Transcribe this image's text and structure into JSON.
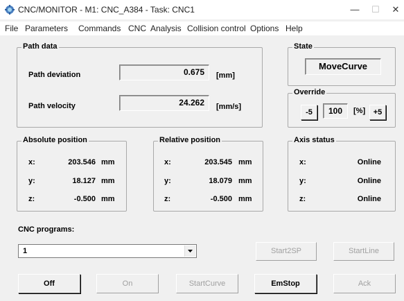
{
  "window": {
    "title": "CNC/MONITOR - M1: CNC_A384 - Task: CNC1",
    "minimize_glyph": "—",
    "maximize_glyph": "☐",
    "close_glyph": "✕"
  },
  "menu": [
    "File",
    "Parameters",
    "Commands",
    "CNC",
    "Analysis",
    "Collision control",
    "Options",
    "Help"
  ],
  "path_data": {
    "title": "Path data",
    "deviation_label": "Path deviation",
    "deviation_value": "0.675",
    "deviation_unit": "[mm]",
    "velocity_label": "Path velocity",
    "velocity_value": "24.262",
    "velocity_unit": "[mm/s]"
  },
  "state": {
    "title": "State",
    "value": "MoveCurve"
  },
  "override": {
    "title": "Override",
    "minus_label": "-5",
    "value": "100",
    "unit": "[%]",
    "plus_label": "+5"
  },
  "absolute_position": {
    "title": "Absolute position",
    "rows": [
      {
        "axis": "x:",
        "value": "203.546",
        "unit": "mm"
      },
      {
        "axis": "y:",
        "value": "18.127",
        "unit": "mm"
      },
      {
        "axis": "z:",
        "value": "-0.500",
        "unit": "mm"
      }
    ]
  },
  "relative_position": {
    "title": "Relative position",
    "rows": [
      {
        "axis": "x:",
        "value": "203.545",
        "unit": "mm"
      },
      {
        "axis": "y:",
        "value": "18.079",
        "unit": "mm"
      },
      {
        "axis": "z:",
        "value": "-0.500",
        "unit": "mm"
      }
    ]
  },
  "axis_status": {
    "title": "Axis status",
    "rows": [
      {
        "axis": "x:",
        "status": "Online"
      },
      {
        "axis": "y:",
        "status": "Online"
      },
      {
        "axis": "z:",
        "status": "Online"
      }
    ]
  },
  "programs": {
    "label": "CNC programs:",
    "selected": "1"
  },
  "buttons": {
    "start2sp": "Start2SP",
    "startline": "StartLine",
    "off": "Off",
    "on": "On",
    "startcurve": "StartCurve",
    "emstop": "EmStop",
    "ack": "Ack"
  },
  "colors": {
    "disabled_text": "#a0a0a0",
    "background": "#f0f0f0"
  },
  "icons": {
    "app": "cnc-gear-icon",
    "dropdown": "chevron-down-icon"
  }
}
